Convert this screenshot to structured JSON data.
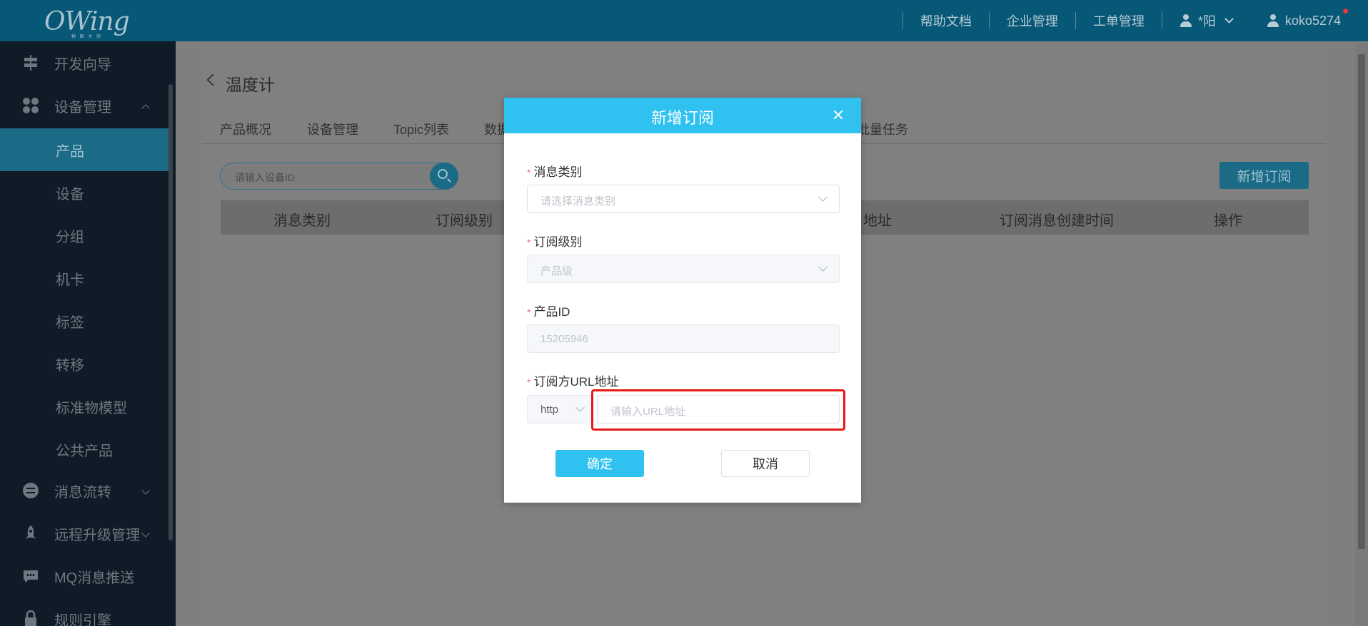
{
  "logo": {
    "text": "OWing",
    "sub": "物 联 大 师"
  },
  "topnav": {
    "help": "帮助文档",
    "enterprise": "企业管理",
    "ticket": "工单管理",
    "account_name": "*阳",
    "username": "koko5274"
  },
  "sidebar": {
    "items": [
      {
        "label": "开发向导",
        "icon": "signpost-icon"
      },
      {
        "label": "设备管理",
        "icon": "grid-icon",
        "expanded": true
      },
      {
        "label": "消息流转",
        "icon": "list-icon"
      },
      {
        "label": "远程升级管理",
        "icon": "rocket-icon"
      },
      {
        "label": "MQ消息推送",
        "icon": "chat-icon"
      },
      {
        "label": "规则引擎",
        "icon": "lock-icon"
      }
    ],
    "sub_items": [
      "产品",
      "设备",
      "分组",
      "机卡",
      "标签",
      "转移",
      "标准物模型",
      "公共产品"
    ],
    "active_sub": "产品"
  },
  "page": {
    "title": "温度计",
    "tabs": [
      "产品概况",
      "设备管理",
      "Topic列表",
      "数据",
      "批量任务"
    ],
    "search_placeholder": "请输入设备ID",
    "add_button": "新增订阅",
    "table_headers": [
      "消息类别",
      "订阅级别",
      "地址",
      "订阅消息创建时间",
      "操作"
    ]
  },
  "dialog": {
    "title": "新增订阅",
    "fields": {
      "msg_type": {
        "label": "消息类别",
        "placeholder": "请选择消息类别"
      },
      "level": {
        "label": "订阅级别",
        "value": "产品级"
      },
      "product_id": {
        "label": "产品ID",
        "value": "15205946"
      },
      "url": {
        "label": "订阅方URL地址",
        "protocol": "http",
        "placeholder": "请输入URL地址"
      }
    },
    "required_mark": "*",
    "ok": "确定",
    "cancel": "取消"
  },
  "colors": {
    "accent": "#2fc2f0",
    "highlight": "#e81818",
    "topbar": "#075776"
  }
}
